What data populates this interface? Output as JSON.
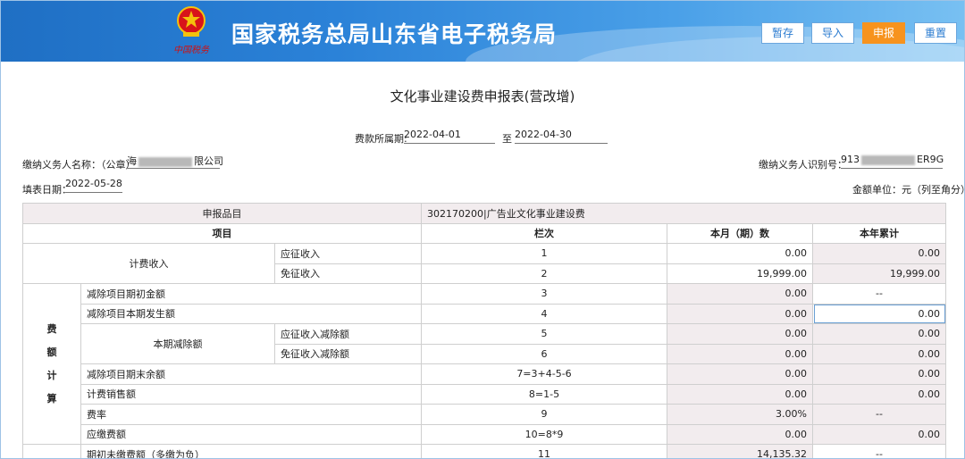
{
  "header": {
    "site_title": "国家税务总局山东省电子税务局",
    "emblem_caption": "中国税务",
    "buttons": {
      "save": "暂存",
      "import": "导入",
      "declare": "申报",
      "reset": "重置"
    }
  },
  "form": {
    "title": "文化事业建设费申报表(营改增)",
    "period_label": "费款所属期:",
    "period_start": "2022-04-01",
    "period_to": "至",
    "period_end": "2022-04-30",
    "payer_name_label": "缴纳义务人名称：（公章）",
    "payer_name_prefix": "海",
    "payer_name_suffix": "限公司",
    "payer_id_label": "缴纳义务人识别号：",
    "payer_id_prefix": "913",
    "payer_id_suffix": "ER9G",
    "fill_date_label": "填表日期：",
    "fill_date": "2022-05-28",
    "unit": "金额单位：元（列至角分）"
  },
  "table": {
    "item_category_label": "申报品目",
    "item_category_value": "302170200|广告业文化事业建设费",
    "headers": {
      "item": "项目",
      "column": "栏次",
      "current": "本月（期）数",
      "ytd": "本年累计"
    },
    "fee_income_label": "计费收入",
    "fee_calc_label": [
      "费",
      "额",
      "计",
      "算"
    ],
    "deduction_current_label": "本期减除额",
    "rows": [
      {
        "name": "应征收入",
        "col": "1",
        "current": "0.00",
        "ytd": "0.00"
      },
      {
        "name": "免征收入",
        "col": "2",
        "current": "19,999.00",
        "ytd": "19,999.00"
      },
      {
        "name": "减除项目期初金额",
        "col": "3",
        "current": "0.00",
        "ytd": "--"
      },
      {
        "name": "减除项目本期发生额",
        "col": "4",
        "current": "0.00",
        "ytd": "0.00"
      },
      {
        "name": "应征收入减除额",
        "col": "5",
        "current": "0.00",
        "ytd": "0.00"
      },
      {
        "name": "免征收入减除额",
        "col": "6",
        "current": "0.00",
        "ytd": "0.00"
      },
      {
        "name": "减除项目期末余额",
        "col": "7=3+4-5-6",
        "current": "0.00",
        "ytd": "0.00"
      },
      {
        "name": "计费销售额",
        "col": "8=1-5",
        "current": "0.00",
        "ytd": "0.00"
      },
      {
        "name": "费率",
        "col": "9",
        "current": "3.00%",
        "ytd": "--"
      },
      {
        "name": "应缴费额",
        "col": "10=8*9",
        "current": "0.00",
        "ytd": "0.00"
      },
      {
        "name": "期初未缴费额（多缴为负）",
        "col": "11",
        "current": "14,135.32",
        "ytd": "--"
      }
    ]
  }
}
